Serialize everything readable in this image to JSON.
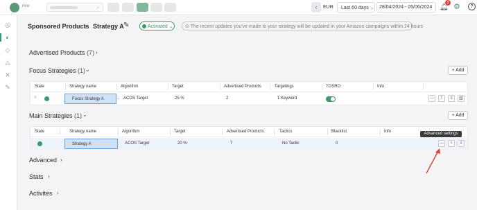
{
  "app": {
    "logo_text": "mre"
  },
  "topbar": {
    "currency": "EUR",
    "period_label": "Last 60 days",
    "date_range": "28/04/2024 - 26/06/2024",
    "notification_count": "3"
  },
  "breadcrumb": {
    "parent": "Sponsored Products",
    "current": "Strategy A"
  },
  "status_label": "Activated",
  "notice": "The recent updates you've made to your strategy will be updated in your Amazon campaigns within 24 hours",
  "advertised_products": {
    "title": "Advertised Products",
    "count": "(7)"
  },
  "focus": {
    "title": "Focus Strategies",
    "count": "(1)",
    "add_label": "+ Add",
    "columns": [
      "State",
      "Strategy name",
      "Algorithm",
      "Target",
      "Advertised Products",
      "Targetings",
      "TOSRO",
      "Info"
    ],
    "row": {
      "name": "Focus Strategy A",
      "algorithm": "ACOS Target",
      "target": "25 %",
      "products": "2",
      "targetings": "1 Keyword",
      "tosro_on": true
    }
  },
  "main": {
    "title": "Main Strategies",
    "count": "(1)",
    "add_label": "+ Add",
    "columns": [
      "State",
      "Strategy name",
      "Algorithm",
      "Target",
      "Advertised Products",
      "Tactics",
      "Blacklist",
      "Info"
    ],
    "row": {
      "name": "Strategy A",
      "algorithm": "ACOS Target",
      "target": "20 %",
      "products": "7",
      "tactics": "No Tactic",
      "blacklist": "0"
    }
  },
  "tooltip": "Advanced settings",
  "sections": {
    "advanced": "Advanced",
    "stats": "Stats",
    "activites": "Activites"
  },
  "colors": {
    "accent": "#3c9a6a",
    "selected_cell": "#cfe2f7",
    "annotation_arrow": "#e0402f"
  }
}
